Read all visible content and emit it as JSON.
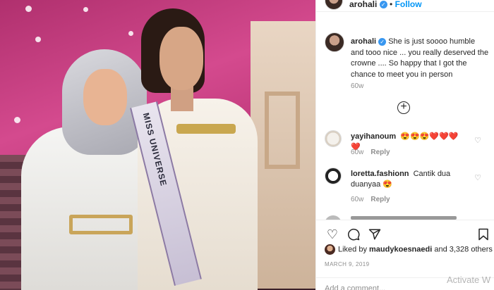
{
  "post": {
    "sash_text": "MISS UNIVERSE"
  },
  "header": {
    "username": "arohali",
    "follow_label": "Follow"
  },
  "caption": {
    "username": "arohali",
    "text": "She is just soooo humble and tooo nice ... you really deserved the crowne .... So happy that I got the chance to meet you in person",
    "time": "60w"
  },
  "comments": [
    {
      "username": "yayihanoum",
      "text": "😍😍😍❤️❤️❤️❤️",
      "time": "60w",
      "reply_label": "Reply"
    },
    {
      "username": "loretta.fashionn",
      "text": "Cantik dua duanyaa 😍",
      "time": "60w",
      "reply_label": "Reply"
    }
  ],
  "likes": {
    "prefix": "Liked by ",
    "user": "maudykoesnaedi",
    "suffix": " and 3,328 others"
  },
  "date": "MARCH 9, 2019",
  "add_comment_placeholder": "Add a comment...",
  "watermark": "Activate W",
  "icons": {
    "like": "heart-icon",
    "comment": "comment-icon",
    "share": "share-icon",
    "save": "bookmark-icon",
    "load_more": "plus-circle-icon"
  },
  "colors": {
    "link": "#0095f6",
    "verified": "#3897f0",
    "muted": "#8e8e8e"
  }
}
